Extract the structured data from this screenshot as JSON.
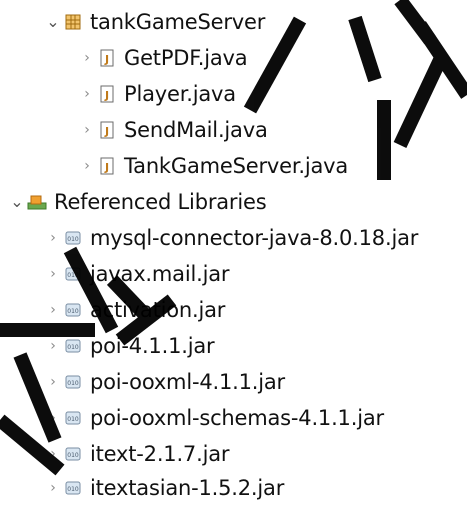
{
  "tree": {
    "package": {
      "label": "tankGameServer",
      "icon": "java-package-icon"
    },
    "java_files": [
      {
        "label": "GetPDF.java",
        "icon": "java-file-icon"
      },
      {
        "label": "Player.java",
        "icon": "java-file-icon"
      },
      {
        "label": "SendMail.java",
        "icon": "java-file-icon"
      },
      {
        "label": "TankGameServer.java",
        "icon": "java-file-icon"
      }
    ],
    "libraries": {
      "label": "Referenced Libraries",
      "icon": "library-container-icon"
    },
    "jars": [
      {
        "label": "mysql-connector-java-8.0.18.jar",
        "icon": "jar-icon"
      },
      {
        "label": "javax.mail.jar",
        "icon": "jar-icon"
      },
      {
        "label": "activation.jar",
        "icon": "jar-icon"
      },
      {
        "label": "poi-4.1.1.jar",
        "icon": "jar-icon"
      },
      {
        "label": "poi-ooxml-4.1.1.jar",
        "icon": "jar-icon"
      },
      {
        "label": "poi-ooxml-schemas-4.1.1.jar",
        "icon": "jar-icon"
      },
      {
        "label": "itext-2.1.7.jar",
        "icon": "jar-icon"
      },
      {
        "label": "itextasian-1.5.2.jar",
        "icon": "jar-icon"
      }
    ]
  },
  "colors": {
    "watermark": "#000000",
    "chevron": "#8a8a8a",
    "package_icon": "#c78a2a",
    "library_icon": "#e08a1e"
  }
}
